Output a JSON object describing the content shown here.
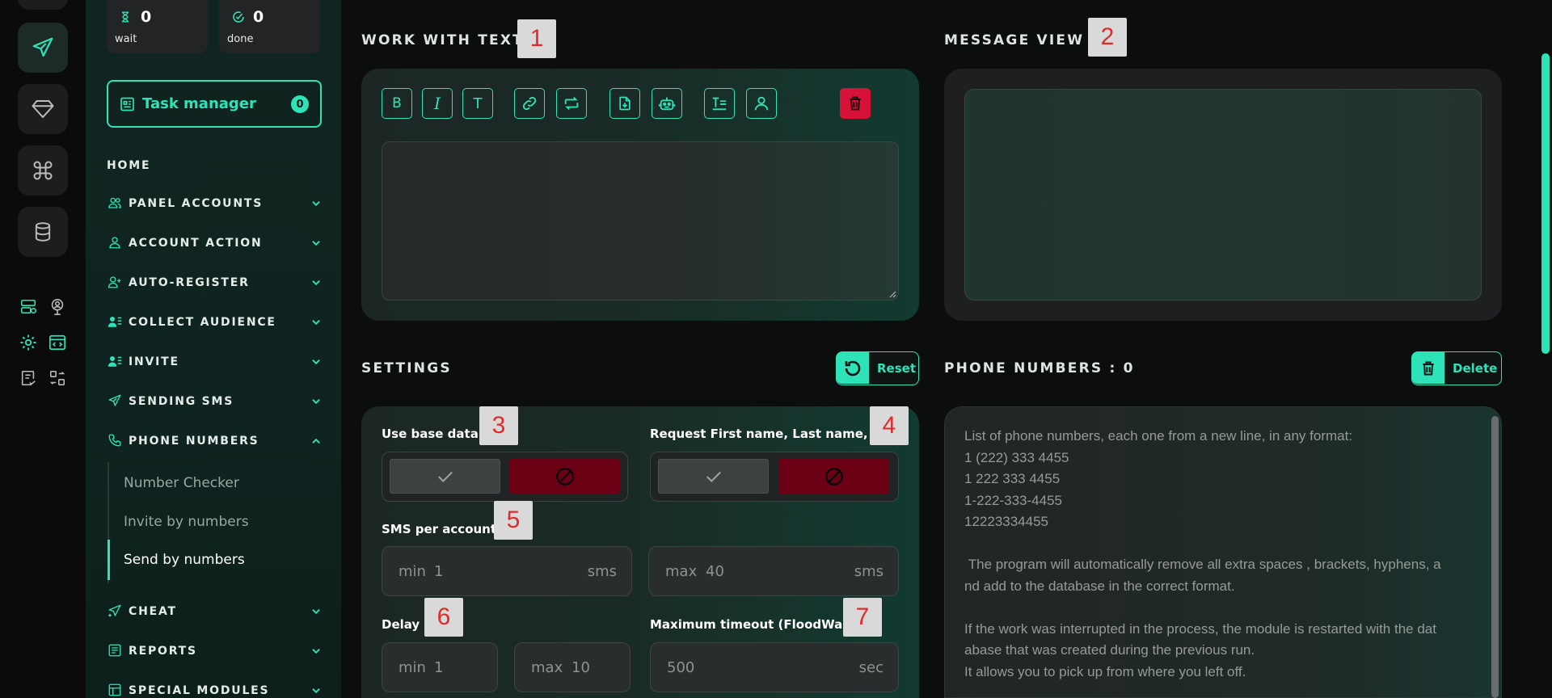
{
  "stats": [
    {
      "value": "0",
      "label": "wait"
    },
    {
      "value": "0",
      "label": "done"
    }
  ],
  "task_manager": {
    "label": "Task manager",
    "count": "0"
  },
  "nav": {
    "home": "HOME",
    "items": [
      {
        "label": "PANEL ACCOUNTS"
      },
      {
        "label": "ACCOUNT ACTION"
      },
      {
        "label": "AUTO-REGISTER"
      },
      {
        "label": "COLLECT AUDIENCE"
      },
      {
        "label": "INVITE"
      },
      {
        "label": "SENDING SMS"
      },
      {
        "label": "PHONE NUMBERS"
      },
      {
        "label": "CHEAT"
      },
      {
        "label": "REPORTS"
      },
      {
        "label": "SPECIAL MODULES"
      }
    ],
    "sub_items": [
      {
        "label": "Number Checker"
      },
      {
        "label": "Invite by numbers"
      },
      {
        "label": "Send by numbers"
      }
    ]
  },
  "sections": {
    "work_with_text": "WORK WITH TEXT",
    "message_view": "MESSAGE VIEW",
    "settings": "SETTINGS",
    "phone_numbers": "PHONE NUMBERS : 0"
  },
  "badges": [
    "1",
    "2",
    "3",
    "4",
    "5",
    "6",
    "7"
  ],
  "toolbar": {
    "bold": "B",
    "italic": "I",
    "text": "T"
  },
  "buttons": {
    "reset": "Reset",
    "delete": "Delete"
  },
  "settings": {
    "use_base_data": "Use base data",
    "request_name": "Request First name, Last name, Bio",
    "sms_per_account": "SMS per account",
    "sms_min": {
      "prefix": "min",
      "value": "1",
      "suffix": "sms"
    },
    "sms_max": {
      "prefix": "max",
      "value": "40",
      "suffix": "sms"
    },
    "delay": "Delay",
    "delay_min": {
      "prefix": "min",
      "value": "1"
    },
    "delay_max": {
      "prefix": "max",
      "value": "10"
    },
    "max_timeout": "Maximum timeout (FloodWait)",
    "timeout": {
      "value": "500",
      "suffix": "sec"
    }
  },
  "phone_numbers_placeholder": "List of phone numbers, each one from a new line, in any format:\n1 (222) 333 4455\n1 222 333 4455\n1-222-333-4455\n12223334455\n\n The program will automatically remove all extra spaces , brackets, hyphens, a\nnd add to the database in the correct format.\n\nIf the work was interrupted in the process, the module is restarted with the dat\nabase that was created during the previous run.\nIt allows you to pick up from where you left off.",
  "colors": {
    "accent": "#2fe3b9",
    "danger": "#d61238",
    "badge_text": "#e02b2b"
  }
}
